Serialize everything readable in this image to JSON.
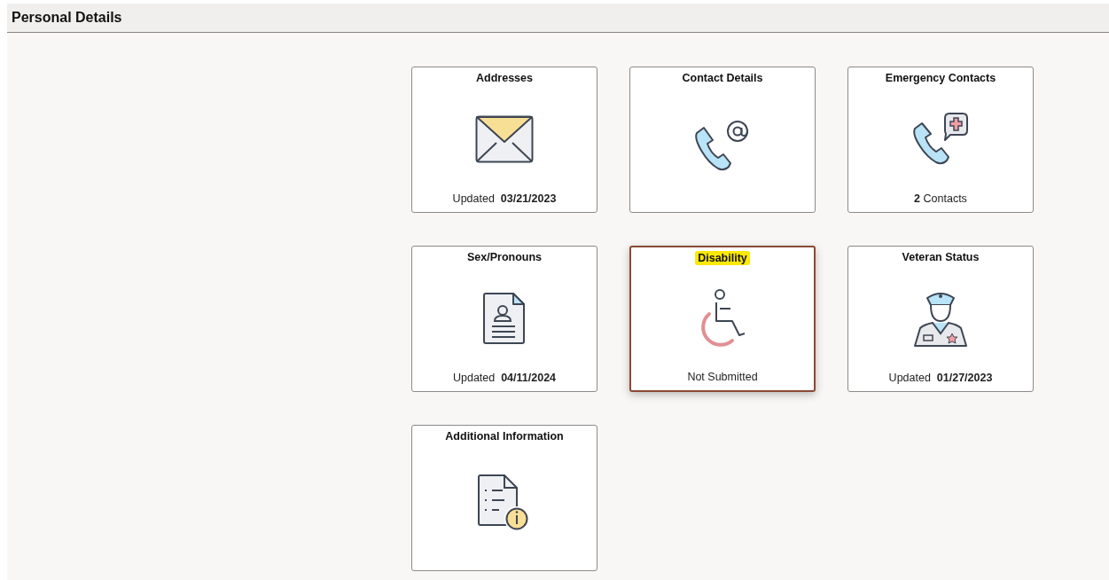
{
  "header": {
    "title": "Personal Details"
  },
  "tiles": [
    {
      "title": "Addresses",
      "kind": "envelope",
      "status": "Updated  **03/21/2023**",
      "selected": false
    },
    {
      "title": "Contact Details",
      "kind": "phone-at",
      "selected": false
    },
    {
      "title": "Emergency Contacts",
      "kind": "phone-medical",
      "status": "**2** Contacts",
      "selected": false
    },
    {
      "title": "Sex/Pronouns",
      "kind": "profile-document",
      "status": "Updated  **04/11/2024**",
      "selected": false
    },
    {
      "title": "Disability",
      "kind": "wheelchair",
      "status": "Not Submitted",
      "selected": true
    },
    {
      "title": "Veteran Status",
      "kind": "officer",
      "status": "Updated  **01/27/2023**",
      "selected": false
    },
    {
      "title": "Additional Information",
      "kind": "info-document",
      "selected": false
    }
  ]
}
